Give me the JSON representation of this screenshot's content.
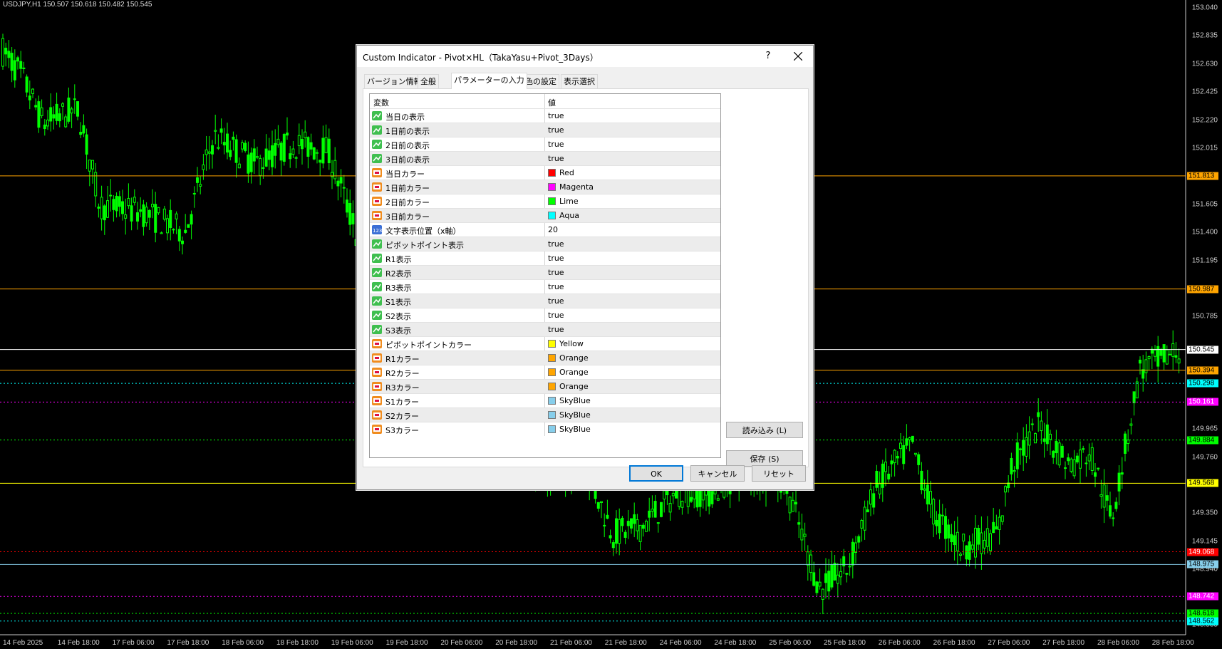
{
  "chart": {
    "symbol_info": "USDJPY,H1  150.507 150.618 150.482 150.545",
    "price_labels": [
      "153.040",
      "152.835",
      "152.630",
      "152.425",
      "152.220",
      "152.015",
      "151.605",
      "151.400",
      "151.195",
      "150.785",
      "149.965",
      "149.760",
      "149.350",
      "149.145",
      "148.940",
      "148.535"
    ],
    "time_labels": [
      "14 Feb 2025",
      "14 Feb 18:00",
      "17 Feb 06:00",
      "17 Feb 18:00",
      "18 Feb 06:00",
      "18 Feb 18:00",
      "19 Feb 06:00",
      "19 Feb 18:00",
      "20 Feb 06:00",
      "20 Feb 18:00",
      "21 Feb 06:00",
      "21 Feb 18:00",
      "24 Feb 06:00",
      "24 Feb 18:00",
      "25 Feb 06:00",
      "25 Feb 18:00",
      "26 Feb 06:00",
      "26 Feb 18:00",
      "27 Feb 06:00",
      "27 Feb 18:00",
      "28 Feb 06:00",
      "28 Feb 18:00"
    ],
    "levels": [
      {
        "price": "151.813",
        "color": "#ffa500",
        "style": "solid"
      },
      {
        "price": "150.987",
        "color": "#ffa500",
        "style": "solid"
      },
      {
        "price": "150.545",
        "color": "#ffffff",
        "style": "solid"
      },
      {
        "price": "150.394",
        "color": "#ffa500",
        "style": "solid"
      },
      {
        "price": "150.298",
        "color": "#00ffff",
        "style": "dotted"
      },
      {
        "price": "150.161",
        "color": "#ff00ff",
        "style": "dotted"
      },
      {
        "price": "149.884",
        "color": "#00ff00",
        "style": "dotted"
      },
      {
        "price": "149.568",
        "color": "#ffff00",
        "style": "solid"
      },
      {
        "price": "149.068",
        "color": "#ff0000",
        "style": "dotted"
      },
      {
        "price": "148.975",
        "color": "#87ceeb",
        "style": "solid"
      },
      {
        "price": "148.742",
        "color": "#ff00ff",
        "style": "dotted"
      },
      {
        "price": "148.618",
        "color": "#00ff00",
        "style": "dotted"
      },
      {
        "price": "148.562",
        "color": "#00ffff",
        "style": "dotted"
      }
    ],
    "candle_color": "#00ff00"
  },
  "dialog": {
    "title": "Custom Indicator - Pivot×HL（TakaYasu+Pivot_3Days）",
    "help": "?",
    "tabs": [
      "バージョン情報",
      "全般",
      "パラメーターの入力",
      "色の設定",
      "表示選択"
    ],
    "active_tab": 2,
    "table": {
      "col_var": "変数",
      "col_val": "値",
      "rows": [
        {
          "name": "当日の表示",
          "value": "true",
          "type": "bool"
        },
        {
          "name": "1日前の表示",
          "value": "true",
          "type": "bool"
        },
        {
          "name": "2日前の表示",
          "value": "true",
          "type": "bool"
        },
        {
          "name": "3日前の表示",
          "value": "true",
          "type": "bool"
        },
        {
          "name": "当日カラー",
          "value": "Red",
          "type": "color",
          "swatch": "#ff0000"
        },
        {
          "name": "1日前カラー",
          "value": "Magenta",
          "type": "color",
          "swatch": "#ff00ff"
        },
        {
          "name": "2日前カラー",
          "value": "Lime",
          "type": "color",
          "swatch": "#00ff00"
        },
        {
          "name": "3日前カラー",
          "value": "Aqua",
          "type": "color",
          "swatch": "#00ffff"
        },
        {
          "name": "文字表示位置（x軸）",
          "value": "20",
          "type": "int"
        },
        {
          "name": "ピボットポイント表示",
          "value": "true",
          "type": "bool"
        },
        {
          "name": "R1表示",
          "value": "true",
          "type": "bool"
        },
        {
          "name": "R2表示",
          "value": "true",
          "type": "bool"
        },
        {
          "name": "R3表示",
          "value": "true",
          "type": "bool"
        },
        {
          "name": "S1表示",
          "value": "true",
          "type": "bool"
        },
        {
          "name": "S2表示",
          "value": "true",
          "type": "bool"
        },
        {
          "name": "S3表示",
          "value": "true",
          "type": "bool"
        },
        {
          "name": "ピボットポイントカラー",
          "value": "Yellow",
          "type": "color",
          "swatch": "#ffff00"
        },
        {
          "name": "R1カラー",
          "value": "Orange",
          "type": "color",
          "swatch": "#ffa500"
        },
        {
          "name": "R2カラー",
          "value": "Orange",
          "type": "color",
          "swatch": "#ffa500"
        },
        {
          "name": "R3カラー",
          "value": "Orange",
          "type": "color",
          "swatch": "#ffa500"
        },
        {
          "name": "S1カラー",
          "value": "SkyBlue",
          "type": "color",
          "swatch": "#87ceeb"
        },
        {
          "name": "S2カラー",
          "value": "SkyBlue",
          "type": "color",
          "swatch": "#87ceeb"
        },
        {
          "name": "S3カラー",
          "value": "SkyBlue",
          "type": "color",
          "swatch": "#87ceeb"
        }
      ]
    },
    "load_button": "読み込み (L)",
    "save_button": "保存 (S)",
    "ok_button": "OK",
    "cancel_button": "キャンセル",
    "reset_button": "リセット"
  }
}
